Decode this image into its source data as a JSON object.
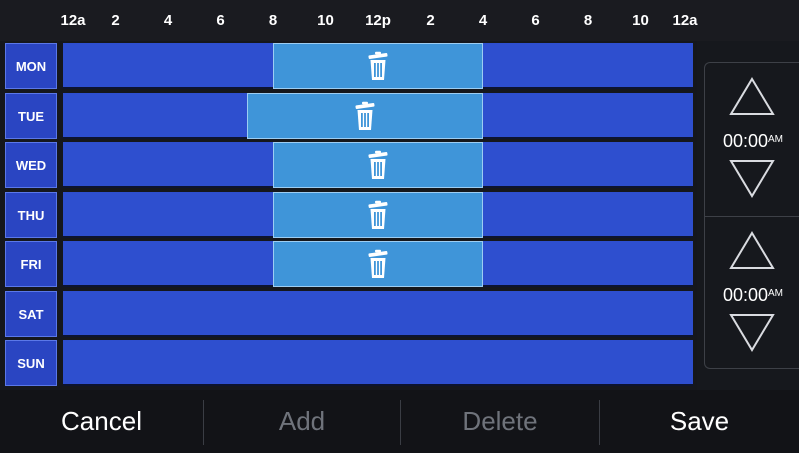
{
  "hour_labels": [
    "12a",
    "2",
    "4",
    "6",
    "8",
    "10",
    "12p",
    "2",
    "4",
    "6",
    "8",
    "10",
    "12a"
  ],
  "days": [
    {
      "label": "MON",
      "block": {
        "start_hour": 8.0,
        "end_hour": 16.0
      }
    },
    {
      "label": "TUE",
      "block": {
        "start_hour": 7.0,
        "end_hour": 16.0
      }
    },
    {
      "label": "WED",
      "block": {
        "start_hour": 8.0,
        "end_hour": 16.0
      }
    },
    {
      "label": "THU",
      "block": {
        "start_hour": 8.0,
        "end_hour": 16.0
      }
    },
    {
      "label": "FRI",
      "block": {
        "start_hour": 8.0,
        "end_hour": 16.0
      }
    },
    {
      "label": "SAT",
      "block": null
    },
    {
      "label": "SUN",
      "block": null
    }
  ],
  "time_panel": {
    "start": {
      "value": "00:00",
      "ampm": "AM"
    },
    "end": {
      "value": "00:00",
      "ampm": "AM"
    }
  },
  "actions": {
    "cancel": "Cancel",
    "add": "Add",
    "delete": "Delete",
    "save": "Save"
  },
  "icons": {
    "delete_block": "trash-icon",
    "increase_time": "triangle-up-icon",
    "decrease_time": "triangle-down-icon"
  },
  "colors": {
    "track": "#2e4fcf",
    "day_label": "#2a45c2",
    "scheduled_block": "#3f95d9",
    "disabled_text": "#6f737b"
  }
}
